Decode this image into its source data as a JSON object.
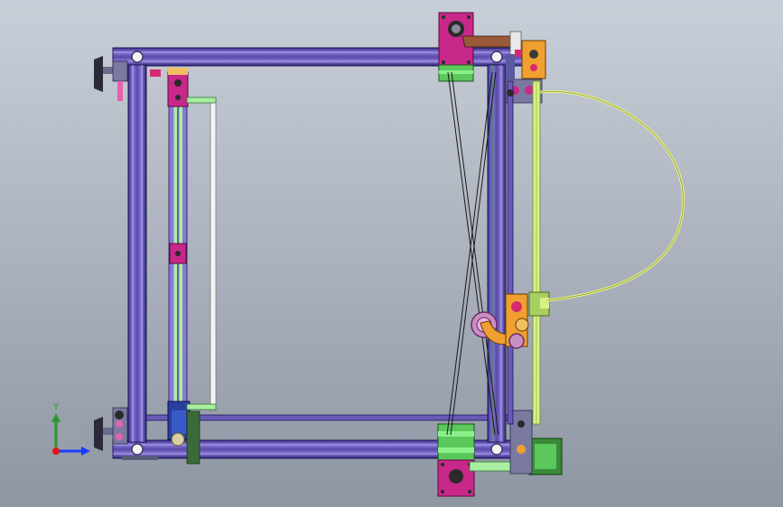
{
  "viewport": {
    "background_top": "#c9cfd8",
    "background_bottom": "#8e96a3"
  },
  "triad": {
    "y_label": "Y",
    "x_color": "#1a3cff",
    "y_color": "#2a9a2a",
    "z_color": "#e01818"
  },
  "colors": {
    "frame_profile": "#5a4aa8",
    "frame_edge": "#2a2270",
    "motor_mount": "#c8288a",
    "stepper_motor": "#6ad66a",
    "carriage": "#f0a030",
    "cable": "#e8f088",
    "rod_green": "#a8f0a0"
  }
}
